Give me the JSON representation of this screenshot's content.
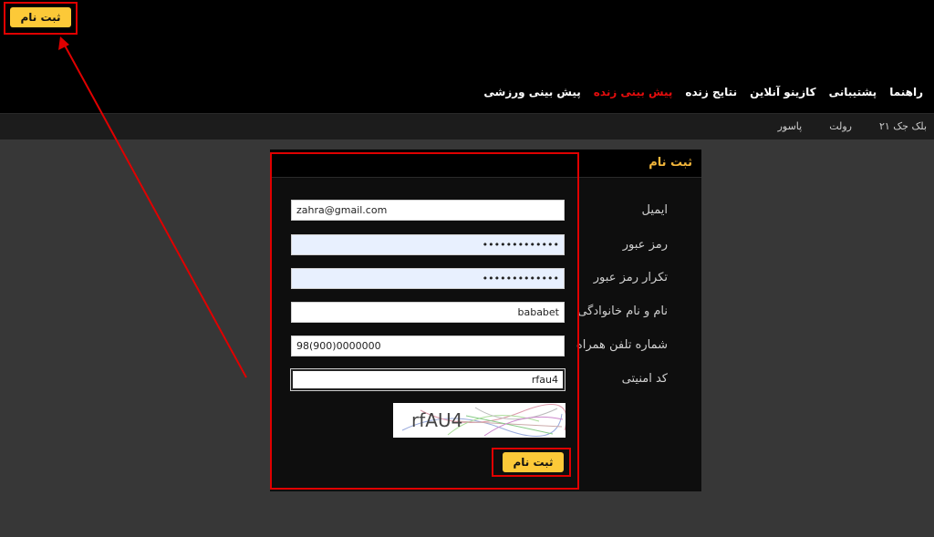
{
  "header": {
    "register_button": "ثبت نام"
  },
  "main_nav": [
    {
      "label": "پیش بینی ورزشی",
      "active": false
    },
    {
      "label": "پیش بینی زنده",
      "active": true
    },
    {
      "label": "نتایج زنده",
      "active": false
    },
    {
      "label": "کازینو آنلاین",
      "active": false
    },
    {
      "label": "پشتیبانی",
      "active": false
    },
    {
      "label": "راهنما",
      "active": false
    }
  ],
  "sub_nav": [
    {
      "label": "پاسور"
    },
    {
      "label": "رولت"
    },
    {
      "label": "بلک جک ۲۱"
    }
  ],
  "form": {
    "title": "ثبت نام",
    "email": {
      "label": "ایمیل",
      "value": "zahra@gmail.com"
    },
    "password": {
      "label": "رمز عبور",
      "value": "•••••••••••••"
    },
    "password_confirm": {
      "label": "تکرار رمز عبور",
      "value": "•••••••••••••"
    },
    "full_name": {
      "label": "نام و نام خانوادگی",
      "value": "bababet"
    },
    "phone": {
      "label": "شماره تلفن همراه",
      "value": "98(900)0000000"
    },
    "security_code": {
      "label": "کد امنیتی",
      "value": "rfau4"
    },
    "captcha_text": "rfAU4",
    "submit_label": "ثبت نام"
  },
  "colors": {
    "accent_yellow": "#fcc938",
    "title_gold": "#f4b73b",
    "active_red": "#e40d0d",
    "annotation_red": "#e00000"
  }
}
